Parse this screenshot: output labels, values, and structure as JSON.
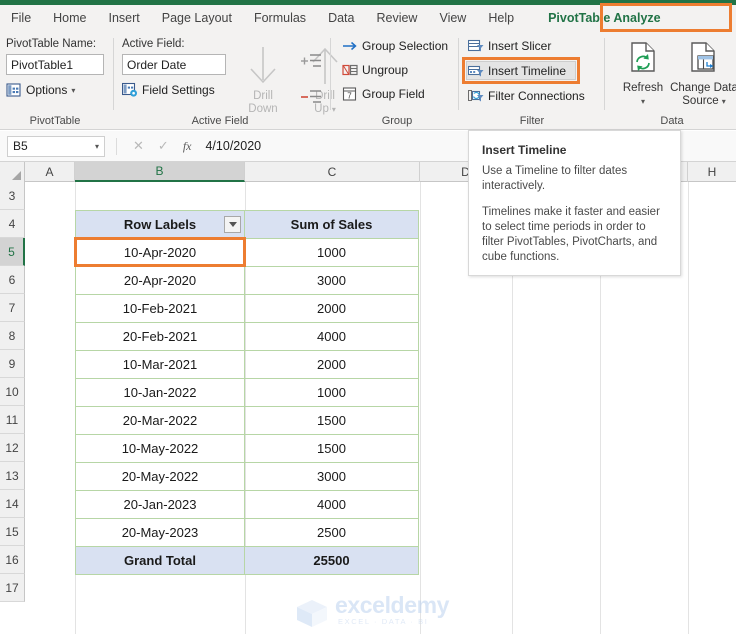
{
  "window": {
    "accent_green": "#217346",
    "highlight_orange": "#ED7D31"
  },
  "ribbon_tabs": [
    {
      "name": "tab-file",
      "label": "File"
    },
    {
      "name": "tab-home",
      "label": "Home"
    },
    {
      "name": "tab-insert",
      "label": "Insert"
    },
    {
      "name": "tab-page-layout",
      "label": "Page Layout"
    },
    {
      "name": "tab-formulas",
      "label": "Formulas"
    },
    {
      "name": "tab-data",
      "label": "Data"
    },
    {
      "name": "tab-review",
      "label": "Review"
    },
    {
      "name": "tab-view",
      "label": "View"
    },
    {
      "name": "tab-help",
      "label": "Help"
    },
    {
      "name": "tab-pivottable-analyze",
      "label": "PivotTable Analyze"
    }
  ],
  "ribbon": {
    "pivottable_group": {
      "group_label": "PivotTable",
      "name_label": "PivotTable Name:",
      "name_value": "PivotTable1",
      "options_label": "Options"
    },
    "active_field_group": {
      "group_label": "Active Field",
      "field_label": "Active Field:",
      "field_value": "Order Date",
      "field_settings_label": "Field Settings",
      "drill_down_label": "Drill\nDown",
      "drill_down_line1": "Drill",
      "drill_down_line2": "Down",
      "drill_up_line1": "Drill",
      "drill_up_line2": "Up"
    },
    "group_group": {
      "group_label": "Group",
      "group_selection_label": "Group Selection",
      "ungroup_label": "Ungroup",
      "group_field_label": "Group Field"
    },
    "filter_group": {
      "group_label": "Filter",
      "insert_slicer_label": "Insert Slicer",
      "insert_timeline_label": "Insert Timeline",
      "filter_connections_label": "Filter Connections"
    },
    "data_group": {
      "group_label": "Data",
      "refresh_label": "Refresh",
      "change_data_source_line1": "Change Data",
      "change_data_source_line2": "Source"
    }
  },
  "tooltip": {
    "title": "Insert Timeline",
    "body1": "Use a Timeline to filter dates interactively.",
    "body2": "Timelines make it faster and easier to select time periods in order to filter PivotTables, PivotCharts, and cube functions."
  },
  "formula_bar": {
    "name_box": "B5",
    "cancel_icon": "✕",
    "confirm_icon": "✓",
    "fx_icon": "fx",
    "content": "4/10/2020"
  },
  "grid": {
    "column_headers": [
      "A",
      "B",
      "C",
      "D",
      "H"
    ],
    "selected_column": "B",
    "row_headers": [
      "3",
      "4",
      "5",
      "6",
      "7",
      "8",
      "9",
      "10",
      "11",
      "12",
      "13",
      "14",
      "15",
      "16",
      "17"
    ],
    "selected_row": "5",
    "selected_cell": "B5"
  },
  "pivot_table": {
    "headers": [
      "Row Labels",
      "Sum of Sales"
    ],
    "rows": [
      {
        "label": "10-Apr-2020",
        "value": "1000"
      },
      {
        "label": "20-Apr-2020",
        "value": "3000"
      },
      {
        "label": "10-Feb-2021",
        "value": "2000"
      },
      {
        "label": "20-Feb-2021",
        "value": "4000"
      },
      {
        "label": "10-Mar-2021",
        "value": "2000"
      },
      {
        "label": "10-Jan-2022",
        "value": "1000"
      },
      {
        "label": "20-Mar-2022",
        "value": "1500"
      },
      {
        "label": "10-May-2022",
        "value": "1500"
      },
      {
        "label": "20-May-2022",
        "value": "3000"
      },
      {
        "label": "20-Jan-2023",
        "value": "4000"
      },
      {
        "label": "20-May-2023",
        "value": "2500"
      }
    ],
    "total": {
      "label": "Grand Total",
      "value": "25500"
    }
  },
  "watermark": {
    "text": "exceldemy",
    "subtext": "EXCEL · DATA · BI"
  }
}
